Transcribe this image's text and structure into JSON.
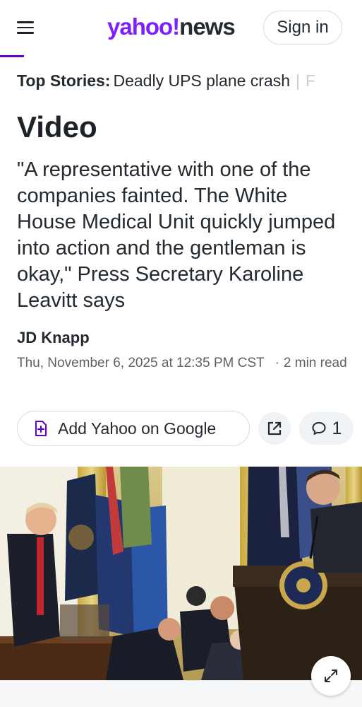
{
  "header": {
    "logo_yahoo": "yahoo!",
    "logo_news": "news",
    "signin_label": "Sign in",
    "accent_color": "#6001d2"
  },
  "top_stories": {
    "label": "Top Stories:",
    "item": "Deadly UPS plane crash",
    "next_item_partial": "F"
  },
  "section_title": "Video",
  "article": {
    "headline": "\"A representative with one of the companies fainted. The White House Medical Unit quickly jumped into action and the gentleman is okay,\" Press Secretary Karoline Leavitt says",
    "author": "JD Knapp",
    "date": "Thu, November 6, 2025 at 12:35 PM CST",
    "read_time": "2 min read"
  },
  "actions": {
    "google_label": "Add Yahoo on Google",
    "google_icon": "google-add-icon",
    "share_icon": "share-external-icon",
    "comments_icon": "comment-icon",
    "comment_count": "1"
  },
  "media": {
    "expand_icon": "expand-icon"
  },
  "colors": {
    "brand_purple": "#7e1fff",
    "text_primary": "#232a31",
    "text_secondary": "#5b636a"
  }
}
